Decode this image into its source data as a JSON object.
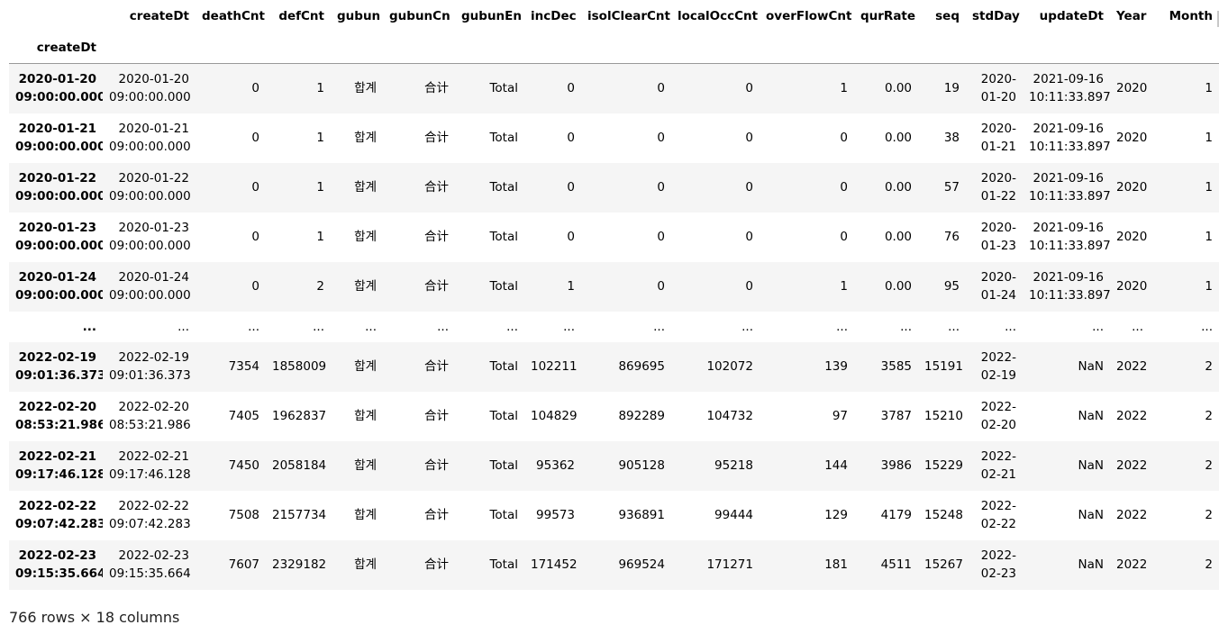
{
  "index_name": "createDt",
  "columns": [
    "createDt",
    "deathCnt",
    "defCnt",
    "gubun",
    "gubunCn",
    "gubunEn",
    "incDec",
    "isolClearCnt",
    "localOccCnt",
    "overFlowCnt",
    "qurRate",
    "seq",
    "stdDay",
    "updateDt",
    "Year",
    "Month"
  ],
  "rows": [
    {
      "index": "2020-01-20 09:00:00.000",
      "cells": [
        "2020-01-20 09:00:00.000",
        "0",
        "1",
        "합계",
        "合计",
        "Total",
        "0",
        "0",
        "0",
        "1",
        "0.00",
        "19",
        "2020-01-20",
        "2021-09-16 10:11:33.897",
        "2020",
        "1"
      ]
    },
    {
      "index": "2020-01-21 09:00:00.000",
      "cells": [
        "2020-01-21 09:00:00.000",
        "0",
        "1",
        "합계",
        "合计",
        "Total",
        "0",
        "0",
        "0",
        "0",
        "0.00",
        "38",
        "2020-01-21",
        "2021-09-16 10:11:33.897",
        "2020",
        "1"
      ]
    },
    {
      "index": "2020-01-22 09:00:00.000",
      "cells": [
        "2020-01-22 09:00:00.000",
        "0",
        "1",
        "합계",
        "合计",
        "Total",
        "0",
        "0",
        "0",
        "0",
        "0.00",
        "57",
        "2020-01-22",
        "2021-09-16 10:11:33.897",
        "2020",
        "1"
      ]
    },
    {
      "index": "2020-01-23 09:00:00.000",
      "cells": [
        "2020-01-23 09:00:00.000",
        "0",
        "1",
        "합계",
        "合计",
        "Total",
        "0",
        "0",
        "0",
        "0",
        "0.00",
        "76",
        "2020-01-23",
        "2021-09-16 10:11:33.897",
        "2020",
        "1"
      ]
    },
    {
      "index": "2020-01-24 09:00:00.000",
      "cells": [
        "2020-01-24 09:00:00.000",
        "0",
        "2",
        "합계",
        "合计",
        "Total",
        "1",
        "0",
        "0",
        "1",
        "0.00",
        "95",
        "2020-01-24",
        "2021-09-16 10:11:33.897",
        "2020",
        "1"
      ]
    },
    {
      "index": "...",
      "cells": [
        "...",
        "...",
        "...",
        "...",
        "...",
        "...",
        "...",
        "...",
        "...",
        "...",
        "...",
        "...",
        "...",
        "...",
        "...",
        "..."
      ],
      "ellipsis": true
    },
    {
      "index": "2022-02-19 09:01:36.373",
      "cells": [
        "2022-02-19 09:01:36.373",
        "7354",
        "1858009",
        "합계",
        "合计",
        "Total",
        "102211",
        "869695",
        "102072",
        "139",
        "3585",
        "15191",
        "2022-02-19",
        "NaN",
        "2022",
        "2"
      ]
    },
    {
      "index": "2022-02-20 08:53:21.986",
      "cells": [
        "2022-02-20 08:53:21.986",
        "7405",
        "1962837",
        "합계",
        "合计",
        "Total",
        "104829",
        "892289",
        "104732",
        "97",
        "3787",
        "15210",
        "2022-02-20",
        "NaN",
        "2022",
        "2"
      ]
    },
    {
      "index": "2022-02-21 09:17:46.128",
      "cells": [
        "2022-02-21 09:17:46.128",
        "7450",
        "2058184",
        "합계",
        "合计",
        "Total",
        "95362",
        "905128",
        "95218",
        "144",
        "3986",
        "15229",
        "2022-02-21",
        "NaN",
        "2022",
        "2"
      ]
    },
    {
      "index": "2022-02-22 09:07:42.283",
      "cells": [
        "2022-02-22 09:07:42.283",
        "7508",
        "2157734",
        "합계",
        "合计",
        "Total",
        "99573",
        "936891",
        "99444",
        "129",
        "4179",
        "15248",
        "2022-02-22",
        "NaN",
        "2022",
        "2"
      ]
    },
    {
      "index": "2022-02-23 09:15:35.664",
      "cells": [
        "2022-02-23 09:15:35.664",
        "7607",
        "2329182",
        "합계",
        "合计",
        "Total",
        "171452",
        "969524",
        "171271",
        "181",
        "4511",
        "15267",
        "2022-02-23",
        "NaN",
        "2022",
        "2"
      ]
    }
  ],
  "summary": "766 rows × 18 columns"
}
